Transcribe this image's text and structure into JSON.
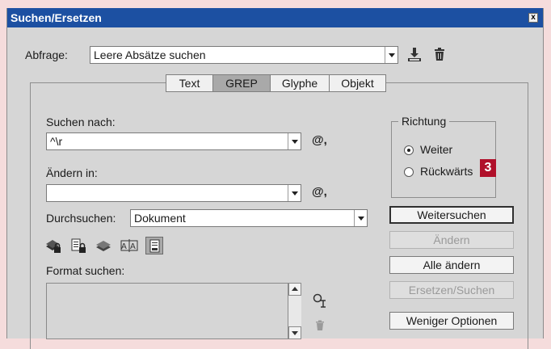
{
  "window": {
    "title": "Suchen/Ersetzen",
    "close_glyph": "x"
  },
  "query": {
    "label": "Abfrage:",
    "value": "Leere Absätze suchen"
  },
  "tabs": [
    {
      "label": "Text"
    },
    {
      "label": "GREP",
      "active": true
    },
    {
      "label": "Glyphe"
    },
    {
      "label": "Objekt"
    }
  ],
  "find": {
    "label": "Suchen nach:",
    "value": "^\\r",
    "special_char": "@,"
  },
  "change": {
    "label": "Ändern in:",
    "value": "",
    "special_char": "@,"
  },
  "search_in": {
    "label": "Durchsuchen:",
    "value": "Dokument"
  },
  "format": {
    "label": "Format suchen:"
  },
  "direction": {
    "title": "Richtung",
    "options": [
      {
        "label": "Weiter",
        "checked": true
      },
      {
        "label": "Rückwärts",
        "checked": false
      }
    ]
  },
  "callout": {
    "number": "3"
  },
  "buttons": {
    "find_next": "Weitersuchen",
    "change": "Ändern",
    "change_all": "Alle ändern",
    "replace_find": "Ersetzen/Suchen",
    "fewer_options": "Weniger Optionen"
  },
  "icons": {
    "save_query": "save-query-icon",
    "delete_query": "trash-icon",
    "format_settings": "format-settings-icon",
    "format_delete": "trash-icon"
  },
  "colors": {
    "titlebar": "#1c50a2",
    "dialog_bg": "#d6d6d6",
    "callout": "#b0102a"
  }
}
